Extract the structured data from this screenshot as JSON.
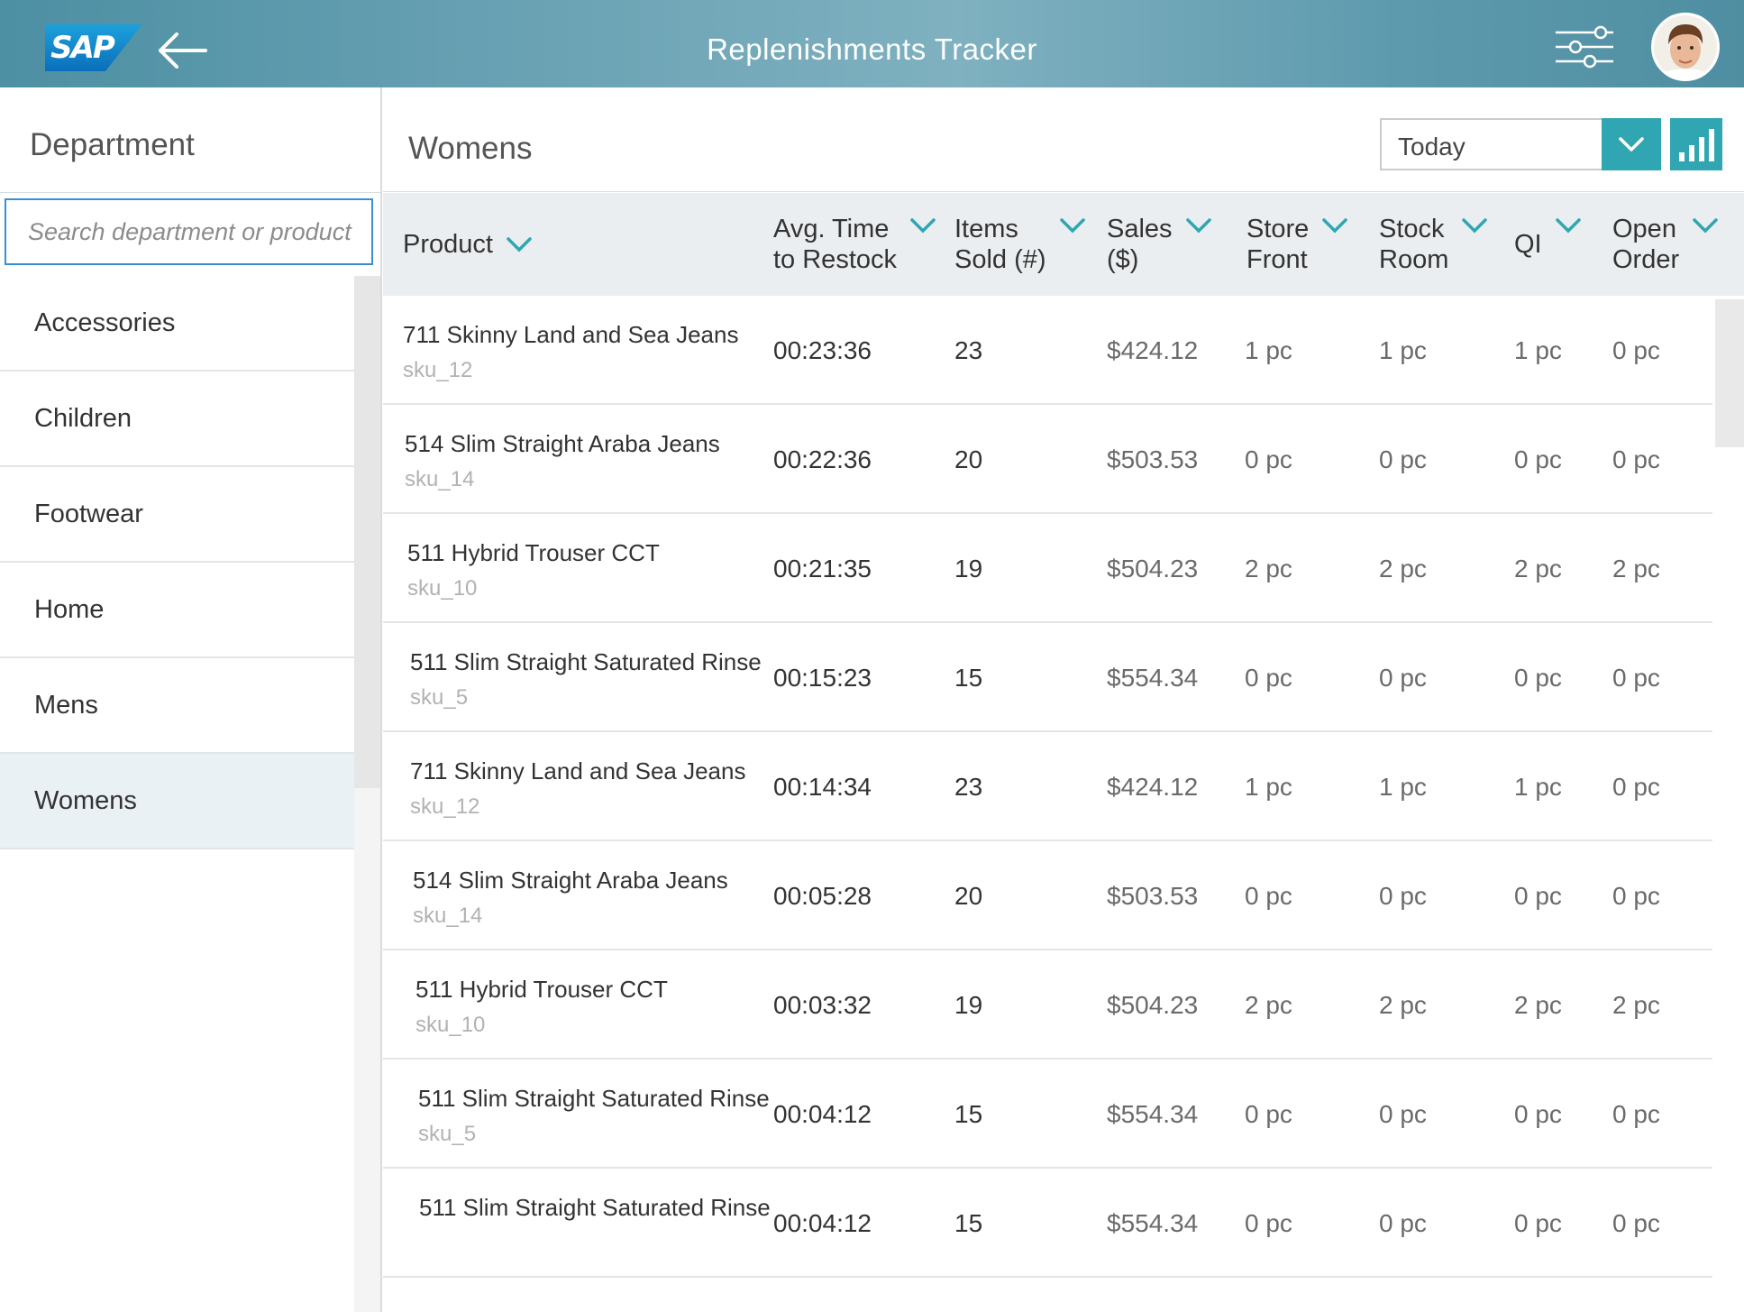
{
  "header": {
    "logo_text": "SAP",
    "title": "Replenishments Tracker",
    "back_icon": "arrow-left-icon",
    "filter_icon": "sliders-icon",
    "avatar_icon": "user-avatar"
  },
  "sidebar": {
    "title": "Department",
    "search_placeholder": "Search department or product",
    "items": [
      {
        "label": "Accessories"
      },
      {
        "label": "Children"
      },
      {
        "label": "Footwear"
      },
      {
        "label": "Home"
      },
      {
        "label": "Mens"
      },
      {
        "label": "Womens",
        "selected": true
      }
    ]
  },
  "main": {
    "title": "Womens",
    "period": "Today",
    "accent_color": "#2fa6b1",
    "columns": [
      {
        "label": "Product"
      },
      {
        "label": "Avg. Time\nto Restock"
      },
      {
        "label": "Items\nSold (#)"
      },
      {
        "label": "Sales\n($)"
      },
      {
        "label": "Store\nFront"
      },
      {
        "label": "Stock\nRoom"
      },
      {
        "label": "QI"
      },
      {
        "label": "Open\nOrder"
      }
    ],
    "rows": [
      {
        "name": "711 Skinny Land and Sea Jeans",
        "sku": "sku_12",
        "time": "00:23:36",
        "sold": "23",
        "sales": "$424.12",
        "store": "1 pc",
        "stock": "1 pc",
        "qi": "1 pc",
        "open": "0 pc"
      },
      {
        "name": "514 Slim Straight Araba Jeans",
        "sku": "sku_14",
        "time": "00:22:36",
        "sold": "20",
        "sales": "$503.53",
        "store": "0 pc",
        "stock": "0 pc",
        "qi": "0 pc",
        "open": "0 pc"
      },
      {
        "name": "511 Hybrid Trouser CCT",
        "sku": "sku_10",
        "time": "00:21:35",
        "sold": "19",
        "sales": "$504.23",
        "store": "2 pc",
        "stock": "2 pc",
        "qi": "2 pc",
        "open": "2 pc"
      },
      {
        "name": "511 Slim Straight Saturated Rinse",
        "sku": "sku_5",
        "time": "00:15:23",
        "sold": "15",
        "sales": "$554.34",
        "store": "0 pc",
        "stock": "0 pc",
        "qi": "0 pc",
        "open": "0 pc"
      },
      {
        "name": "711 Skinny Land and Sea Jeans",
        "sku": "sku_12",
        "time": "00:14:34",
        "sold": "23",
        "sales": "$424.12",
        "store": "1 pc",
        "stock": "1 pc",
        "qi": "1 pc",
        "open": "0 pc"
      },
      {
        "name": "514 Slim Straight Araba Jeans",
        "sku": "sku_14",
        "time": "00:05:28",
        "sold": "20",
        "sales": "$503.53",
        "store": "0 pc",
        "stock": "0 pc",
        "qi": "0 pc",
        "open": "0 pc"
      },
      {
        "name": "511 Hybrid Trouser CCT",
        "sku": "sku_10",
        "time": "00:03:32",
        "sold": "19",
        "sales": "$504.23",
        "store": "2 pc",
        "stock": "2 pc",
        "qi": "2 pc",
        "open": "2 pc"
      },
      {
        "name": "511 Slim Straight Saturated Rinse",
        "sku": "sku_5",
        "time": "00:04:12",
        "sold": "15",
        "sales": "$554.34",
        "store": "0 pc",
        "stock": "0 pc",
        "qi": "0 pc",
        "open": "0 pc"
      },
      {
        "name": "511 Slim Straight Saturated Rinse",
        "sku": "",
        "time": "00:04:12",
        "sold": "15",
        "sales": "$554.34",
        "store": "0 pc",
        "stock": "0 pc",
        "qi": "0 pc",
        "open": "0 pc"
      }
    ]
  }
}
